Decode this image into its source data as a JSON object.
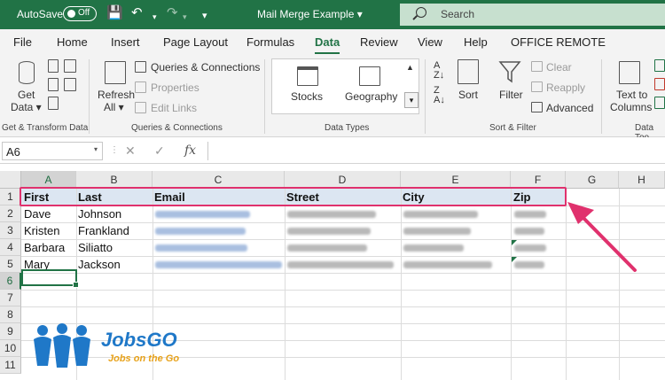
{
  "titlebar": {
    "autosave_label": "AutoSave",
    "autosave_state": "Off",
    "document_title": "Mail Merge Example ▾",
    "search_placeholder": "Search"
  },
  "tabs": [
    "File",
    "Home",
    "Insert",
    "Page Layout",
    "Formulas",
    "Data",
    "Review",
    "View",
    "Help",
    "OFFICE REMOTE"
  ],
  "active_tab": "Data",
  "ribbon": {
    "get_data_1": "Get",
    "get_data_2": "Data ▾",
    "group_get_transform": "Get & Transform Data",
    "refresh_1": "Refresh",
    "refresh_2": "All ▾",
    "queries_connections": "Queries & Connections",
    "properties": "Properties",
    "edit_links": "Edit Links",
    "group_queries": "Queries & Connections",
    "stocks": "Stocks",
    "geography": "Geography",
    "group_data_types": "Data Types",
    "sort": "Sort",
    "filter": "Filter",
    "clear": "Clear",
    "reapply": "Reapply",
    "advanced": "Advanced",
    "group_sort_filter": "Sort & Filter",
    "text_to_1": "Text to",
    "text_to_2": "Columns",
    "group_data_tools": "Data Too"
  },
  "formula_bar": {
    "name_box": "A6",
    "fx": "fx",
    "formula": ""
  },
  "columns": [
    "A",
    "B",
    "C",
    "D",
    "E",
    "F",
    "G",
    "H"
  ],
  "rows": [
    "1",
    "2",
    "3",
    "4",
    "5",
    "6",
    "7",
    "8",
    "9",
    "10",
    "11"
  ],
  "header_row": {
    "first": "First",
    "last": "Last",
    "email": "Email",
    "street": "Street",
    "city": "City",
    "zip": "Zip"
  },
  "data_rows": [
    {
      "first": "Dave",
      "last": "Johnson"
    },
    {
      "first": "Kristen",
      "last": "Frankland"
    },
    {
      "first": "Barbara",
      "last": "Siliatto"
    },
    {
      "first": "Mary",
      "last": "Jackson"
    }
  ],
  "watermark": {
    "brand": "JobsGO",
    "tagline": "Jobs on the Go"
  },
  "colors": {
    "excel_green": "#217346",
    "highlight": "#e0316d",
    "header_fill": "#dce6f2"
  }
}
